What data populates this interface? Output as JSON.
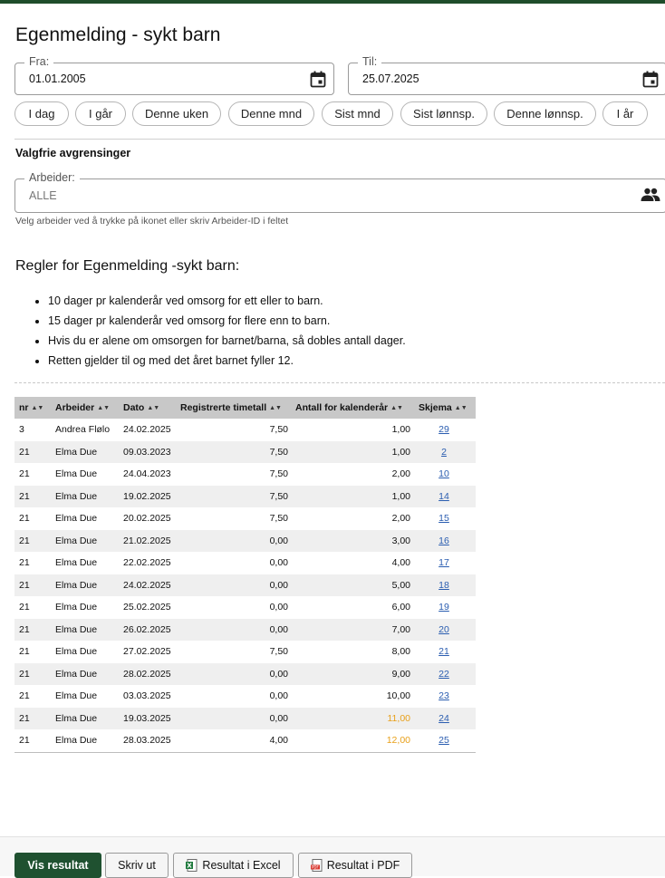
{
  "page": {
    "title": "Egenmelding - sykt barn"
  },
  "filters": {
    "from": {
      "label": "Fra:",
      "value": "01.01.2005"
    },
    "to": {
      "label": "Til:",
      "value": "25.07.2025"
    },
    "quick_ranges": [
      "I dag",
      "I går",
      "Denne uken",
      "Denne mnd",
      "Sist mnd",
      "Sist lønnsp.",
      "Denne lønnsp.",
      "I år"
    ]
  },
  "optional": {
    "heading": "Valgfrie avgrensinger",
    "worker": {
      "label": "Arbeider:",
      "placeholder": "ALLE",
      "hint": "Velg arbeider ved å trykke på ikonet eller skriv Arbeider-ID i feltet"
    }
  },
  "rules": {
    "heading": "Regler for Egenmelding -sykt barn:",
    "items": [
      "10 dager pr kalenderår ved omsorg for ett eller to barn.",
      "15 dager pr kalenderår ved omsorg for flere enn to barn.",
      "Hvis du er alene om omsorgen for barnet/barna, så dobles antall dager.",
      "Retten gjelder til og med det året barnet fyller 12."
    ]
  },
  "table": {
    "columns": [
      "nr",
      "Arbeider",
      "Dato",
      "Registrerte timetall",
      "Antall for kalenderår",
      "Skjema"
    ],
    "rows": [
      {
        "nr": "3",
        "arbeider": "Andrea Flølo",
        "dato": "24.02.2025",
        "timer": "7,50",
        "antall": "1,00",
        "skjema": "29",
        "warn": false
      },
      {
        "nr": "21",
        "arbeider": "Elma Due",
        "dato": "09.03.2023",
        "timer": "7,50",
        "antall": "1,00",
        "skjema": "2",
        "warn": false
      },
      {
        "nr": "21",
        "arbeider": "Elma Due",
        "dato": "24.04.2023",
        "timer": "7,50",
        "antall": "2,00",
        "skjema": "10",
        "warn": false
      },
      {
        "nr": "21",
        "arbeider": "Elma Due",
        "dato": "19.02.2025",
        "timer": "7,50",
        "antall": "1,00",
        "skjema": "14",
        "warn": false
      },
      {
        "nr": "21",
        "arbeider": "Elma Due",
        "dato": "20.02.2025",
        "timer": "7,50",
        "antall": "2,00",
        "skjema": "15",
        "warn": false
      },
      {
        "nr": "21",
        "arbeider": "Elma Due",
        "dato": "21.02.2025",
        "timer": "0,00",
        "antall": "3,00",
        "skjema": "16",
        "warn": false
      },
      {
        "nr": "21",
        "arbeider": "Elma Due",
        "dato": "22.02.2025",
        "timer": "0,00",
        "antall": "4,00",
        "skjema": "17",
        "warn": false
      },
      {
        "nr": "21",
        "arbeider": "Elma Due",
        "dato": "24.02.2025",
        "timer": "0,00",
        "antall": "5,00",
        "skjema": "18",
        "warn": false
      },
      {
        "nr": "21",
        "arbeider": "Elma Due",
        "dato": "25.02.2025",
        "timer": "0,00",
        "antall": "6,00",
        "skjema": "19",
        "warn": false
      },
      {
        "nr": "21",
        "arbeider": "Elma Due",
        "dato": "26.02.2025",
        "timer": "0,00",
        "antall": "7,00",
        "skjema": "20",
        "warn": false
      },
      {
        "nr": "21",
        "arbeider": "Elma Due",
        "dato": "27.02.2025",
        "timer": "7,50",
        "antall": "8,00",
        "skjema": "21",
        "warn": false
      },
      {
        "nr": "21",
        "arbeider": "Elma Due",
        "dato": "28.02.2025",
        "timer": "0,00",
        "antall": "9,00",
        "skjema": "22",
        "warn": false
      },
      {
        "nr": "21",
        "arbeider": "Elma Due",
        "dato": "03.03.2025",
        "timer": "0,00",
        "antall": "10,00",
        "skjema": "23",
        "warn": false
      },
      {
        "nr": "21",
        "arbeider": "Elma Due",
        "dato": "19.03.2025",
        "timer": "0,00",
        "antall": "11,00",
        "skjema": "24",
        "warn": true
      },
      {
        "nr": "21",
        "arbeider": "Elma Due",
        "dato": "28.03.2025",
        "timer": "4,00",
        "antall": "12,00",
        "skjema": "25",
        "warn": true
      }
    ],
    "warn_color": "#e8a01a",
    "header_bg": "#c8c8c8"
  },
  "footer": {
    "show_results": "Vis resultat",
    "print": "Skriv ut",
    "excel": "Resultat i Excel",
    "pdf": "Resultat i PDF",
    "excel_icon": "excel-file-icon",
    "pdf_icon": "pdf-file-icon"
  },
  "colors": {
    "brand": "#1f5130",
    "link": "#2a5db0"
  }
}
